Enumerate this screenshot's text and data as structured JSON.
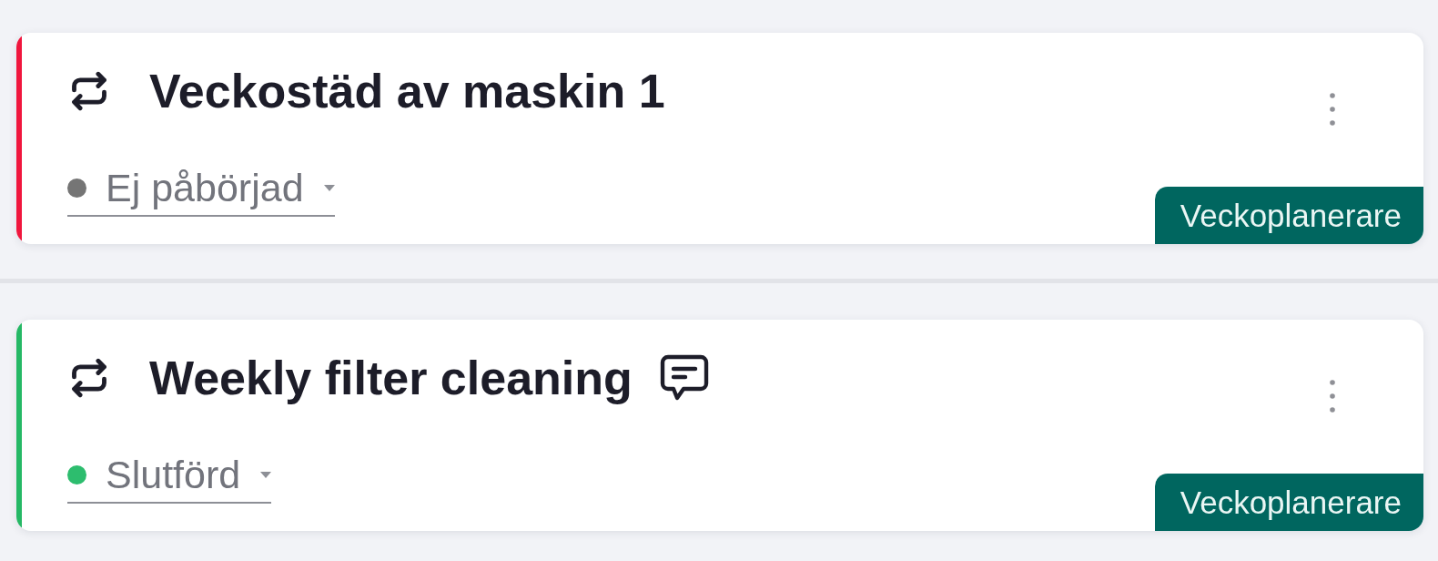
{
  "tasks": [
    {
      "color": "#f0163d",
      "recurring": true,
      "title": "Veckostäd av maskin 1",
      "has_comment": false,
      "status": {
        "label": "Ej påbörjad",
        "color": "#757575"
      },
      "tag": "Veckoplanerare"
    },
    {
      "color": "#25b865",
      "recurring": true,
      "title": "Weekly filter cleaning",
      "has_comment": true,
      "status": {
        "label": "Slutförd",
        "color": "#2dbd6e"
      },
      "tag": "Veckoplanerare"
    }
  ]
}
